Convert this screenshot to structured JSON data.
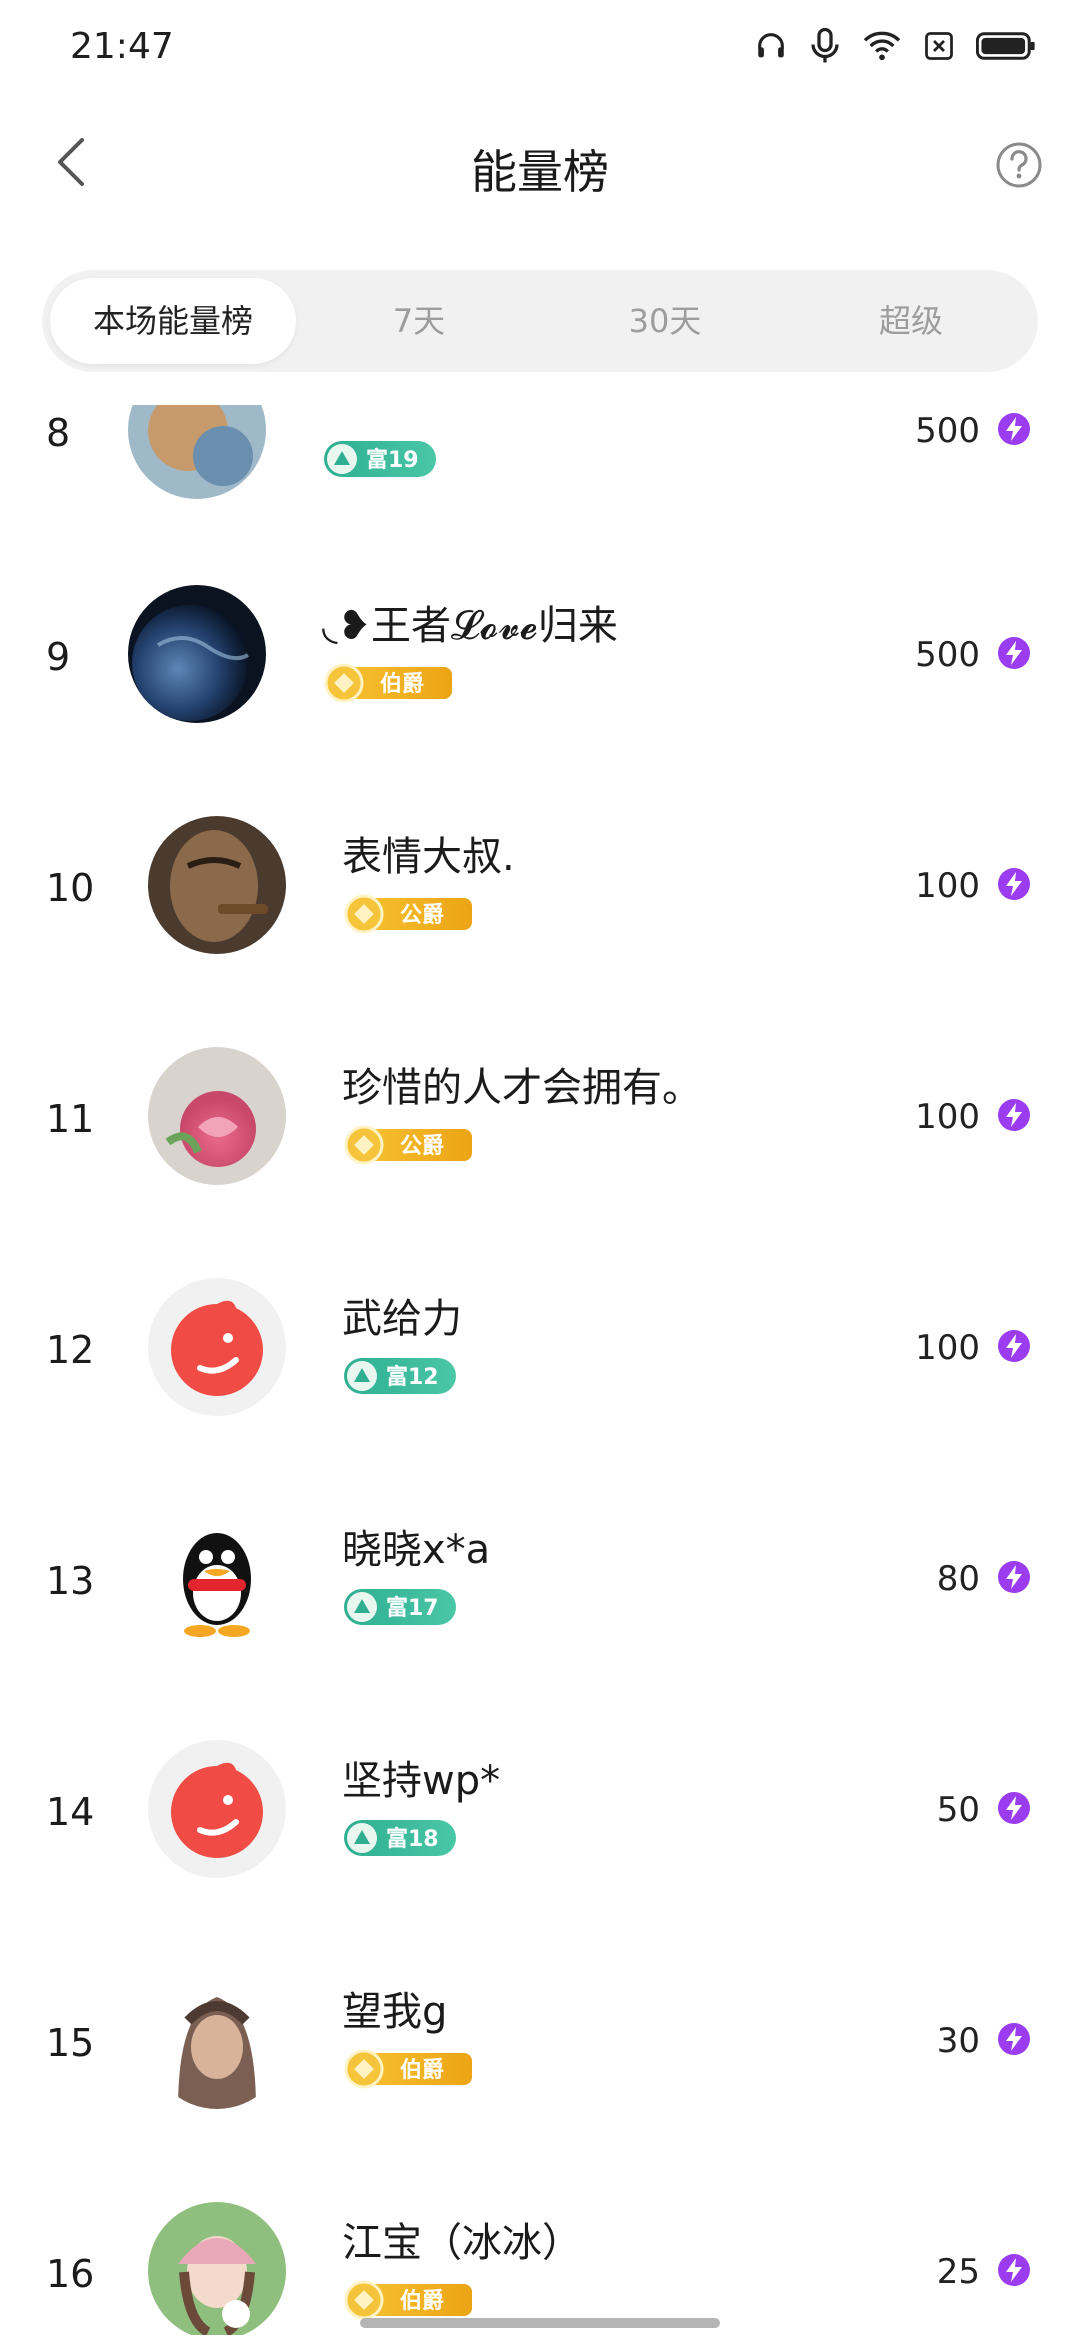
{
  "status_bar": {
    "time": "21:47",
    "icons": [
      "headphones-icon",
      "microphone-icon",
      "wifi-icon",
      "no-sim-icon",
      "battery-icon"
    ]
  },
  "header": {
    "title": "能量榜",
    "back_icon": "chevron-left-icon",
    "help_icon": "help-circle-icon"
  },
  "tabs": [
    {
      "label": "本场能量榜",
      "active": true
    },
    {
      "label": "7天",
      "active": false
    },
    {
      "label": "30天",
      "active": false
    },
    {
      "label": "超级",
      "active": false
    }
  ],
  "partial_row": {
    "rank": "8",
    "badge": {
      "type": "rich",
      "label": "富19"
    },
    "score": "500"
  },
  "rows": [
    {
      "rank": "9",
      "name": "◟❥王者𝓛𝓸𝓿𝓮归来",
      "badge": {
        "type": "noble",
        "label": "伯爵"
      },
      "score": "500"
    },
    {
      "rank": "10",
      "name": "表情大叔.",
      "badge": {
        "type": "noble",
        "label": "公爵"
      },
      "score": "100"
    },
    {
      "rank": "11",
      "name": "珍惜的人才会拥有。",
      "badge": {
        "type": "noble",
        "label": "公爵"
      },
      "score": "100"
    },
    {
      "rank": "12",
      "name": "武给力",
      "badge": {
        "type": "rich",
        "label": "富12"
      },
      "score": "100"
    },
    {
      "rank": "13",
      "name": "晓晓x*a",
      "badge": {
        "type": "rich",
        "label": "富17"
      },
      "score": "80"
    },
    {
      "rank": "14",
      "name": "坚持wp*",
      "badge": {
        "type": "rich",
        "label": "富18"
      },
      "score": "50"
    },
    {
      "rank": "15",
      "name": "望我g",
      "badge": {
        "type": "noble",
        "label": "伯爵"
      },
      "score": "30"
    },
    {
      "rank": "16",
      "name": "江宝（冰冰）",
      "badge": {
        "type": "noble",
        "label": "伯爵"
      },
      "score": "25"
    }
  ],
  "energy_icon": "lightning-icon",
  "colors": {
    "rich_badge": "#3dbd9e",
    "noble_badge": "#f3b21f",
    "energy_purple": "#9b3cf0",
    "tab_bg": "#f1f1f1"
  }
}
